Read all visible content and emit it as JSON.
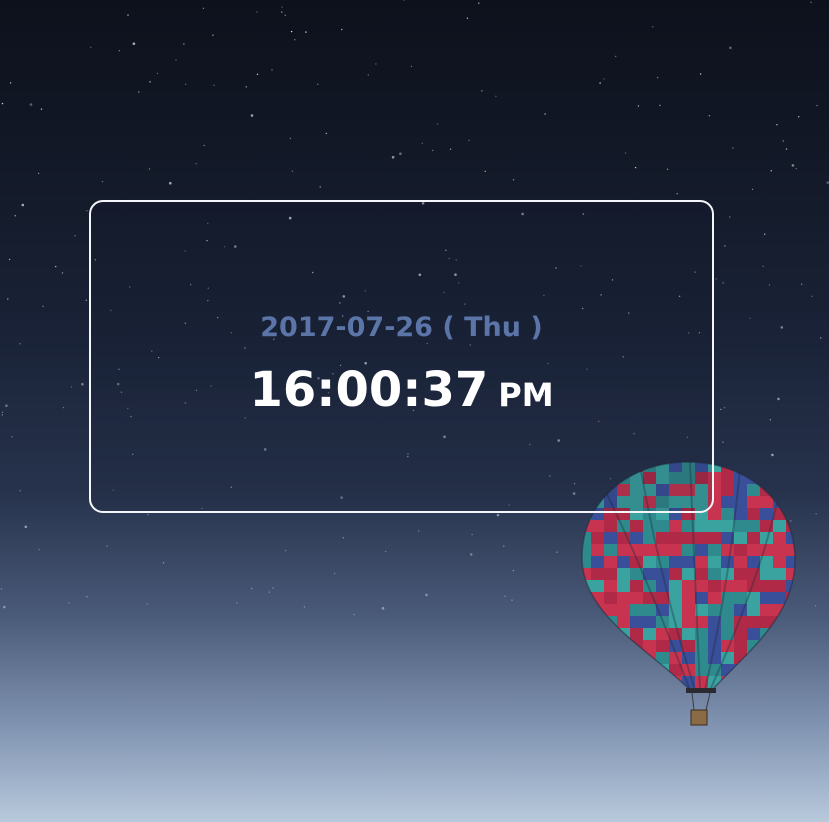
{
  "clock": {
    "date": "2017-07-26",
    "weekday_display": "( Thu )",
    "time": "16:00:37",
    "ampm": "PM"
  },
  "colors": {
    "date_text": "#5b75a8",
    "time_text": "#ffffff",
    "card_border": "#f4f6fa"
  },
  "background": {
    "image_subject": "hot-air-balloon-night-sky"
  }
}
